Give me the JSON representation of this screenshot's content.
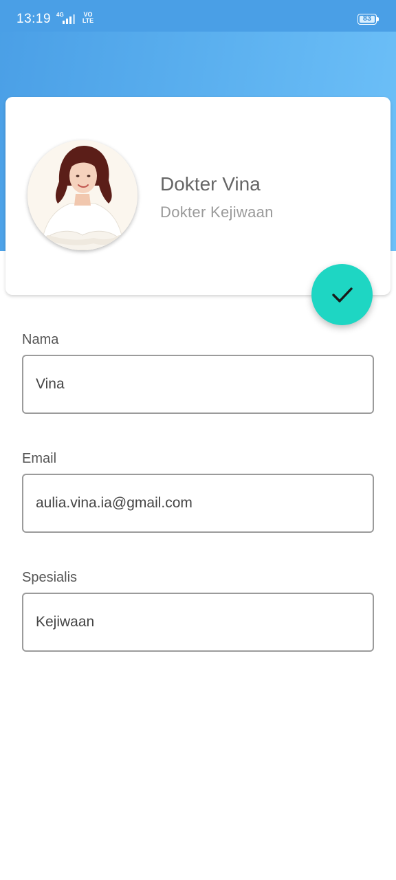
{
  "status_bar": {
    "time": "13:19",
    "network_tag": "4G",
    "volte_top": "VO",
    "volte_bottom": "LTE",
    "battery_level": "83"
  },
  "profile": {
    "name": "Dokter Vina",
    "role": "Dokter Kejiwaan",
    "avatar_icon": "doctor-portrait"
  },
  "save_fab": {
    "icon": "check-icon",
    "color": "#1ed6c3"
  },
  "form": {
    "nama": {
      "label": "Nama",
      "value": "Vina"
    },
    "email": {
      "label": "Email",
      "value": "aulia.vina.ia@gmail.com"
    },
    "spesialis": {
      "label": "Spesialis",
      "value": "Kejiwaan"
    }
  },
  "colors": {
    "header": "#4a9fe6",
    "accent": "#1ed6c3"
  }
}
